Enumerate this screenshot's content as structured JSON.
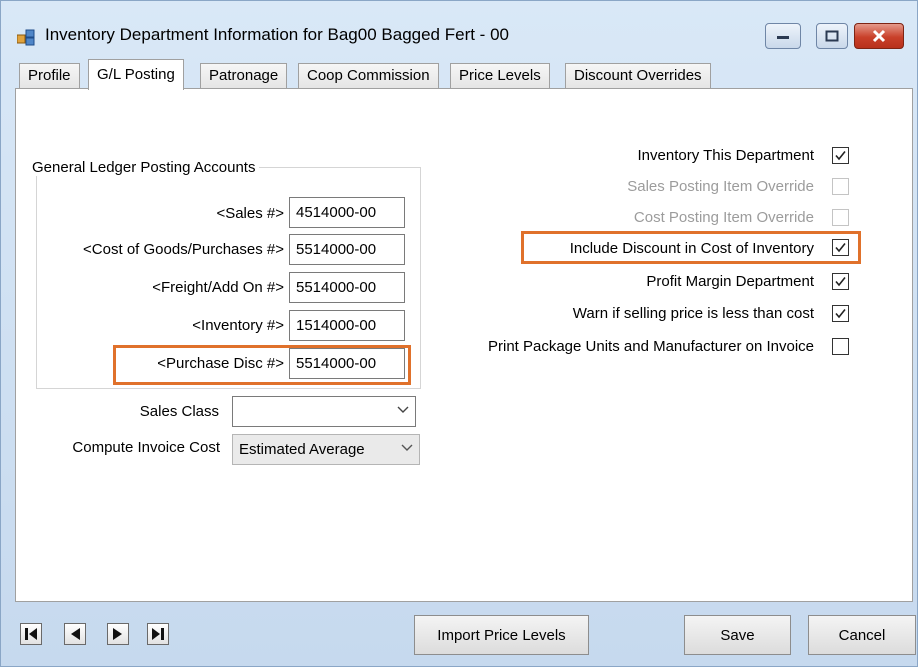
{
  "window": {
    "title": "Inventory Department Information for Bag00  Bagged Fert - 00"
  },
  "tabs": [
    {
      "label": "Profile"
    },
    {
      "label": "G/L Posting"
    },
    {
      "label": "Patronage"
    },
    {
      "label": "Coop Commission"
    },
    {
      "label": "Price Levels"
    },
    {
      "label": "Discount Overrides"
    }
  ],
  "gl_accounts": {
    "group_title": "General Ledger Posting Accounts",
    "sales": {
      "label": "<Sales #>",
      "value": "4514000-00"
    },
    "cogs": {
      "label": "<Cost of Goods/Purchases #>",
      "value": "5514000-00"
    },
    "freight": {
      "label": "<Freight/Add On #>",
      "value": "5514000-00"
    },
    "inventory": {
      "label": "<Inventory #>",
      "value": "1514000-00"
    },
    "purchase_disc": {
      "label": "<Purchase Disc #>",
      "value": "5514000-00"
    }
  },
  "sales_class": {
    "label": "Sales Class",
    "value": ""
  },
  "compute_invoice_cost": {
    "label": "Compute Invoice Cost",
    "value": "Estimated Average"
  },
  "options": {
    "inventory_dept": {
      "label": "Inventory This Department",
      "checked": true
    },
    "sales_posting_override": {
      "label": "Sales Posting Item Override",
      "checked": false
    },
    "cost_posting_override": {
      "label": "Cost Posting Item Override",
      "checked": false
    },
    "include_discount": {
      "label": "Include Discount in Cost of Inventory",
      "checked": true
    },
    "profit_margin": {
      "label": "Profit Margin Department",
      "checked": true
    },
    "warn_selling_price": {
      "label": "Warn if selling price is less than cost",
      "checked": true
    },
    "print_package_units": {
      "label": "Print Package Units and Manufacturer on Invoice",
      "checked": false
    }
  },
  "buttons": {
    "import_price_levels": "Import Price Levels",
    "save": "Save",
    "cancel": "Cancel"
  },
  "colors": {
    "highlight": "#e0712b",
    "close_button": "#c9402a"
  }
}
